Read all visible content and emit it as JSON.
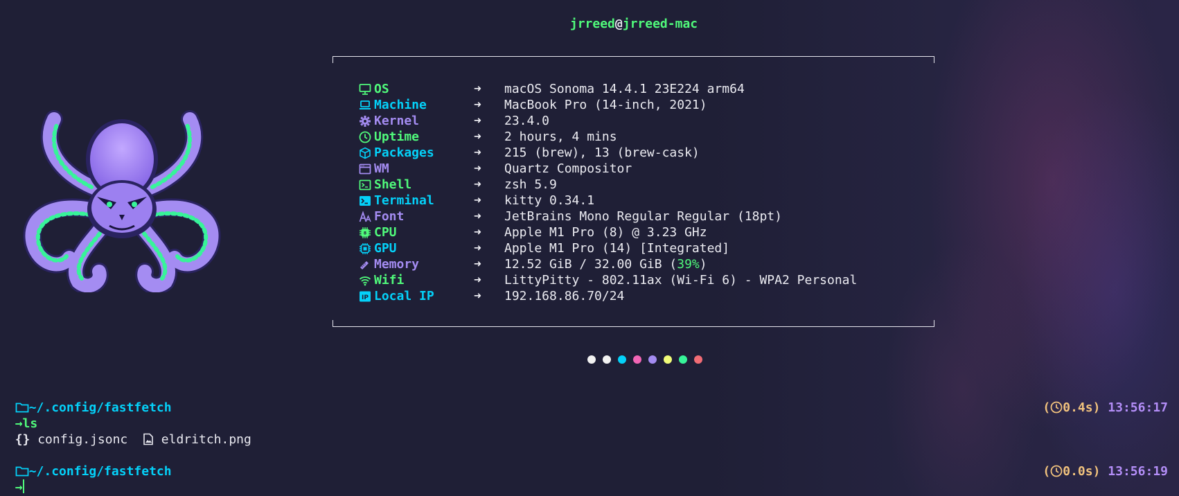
{
  "terminal": {
    "user": "jrreed",
    "at": "@",
    "host": "jrreed-mac",
    "rows": [
      {
        "key": "OS",
        "val": "macOS Sonoma 14.4.1 23E224 arm64",
        "color": "#50fa7b",
        "icon": "monitor-icon"
      },
      {
        "key": "Machine",
        "val": "MacBook Pro (14-inch, 2021)",
        "color": "#04d1f9",
        "icon": "laptop-icon"
      },
      {
        "key": "Kernel",
        "val": "23.4.0",
        "color": "#a48cf2",
        "icon": "gear-icon"
      },
      {
        "key": "Uptime",
        "val": "2 hours, 4 mins",
        "color": "#50fa7b",
        "icon": "clock-icon"
      },
      {
        "key": "Packages",
        "val": "215 (brew), 13 (brew-cask)",
        "color": "#04d1f9",
        "icon": "package-icon"
      },
      {
        "key": "WM",
        "val": "Quartz Compositor",
        "color": "#a48cf2",
        "icon": "window-icon"
      },
      {
        "key": "Shell",
        "val": "zsh 5.9",
        "color": "#50fa7b",
        "icon": "shell-icon"
      },
      {
        "key": "Terminal",
        "val": "kitty 0.34.1",
        "color": "#04d1f9",
        "icon": "terminal-icon"
      },
      {
        "key": "Font",
        "val": "JetBrains Mono Regular Regular (18pt)",
        "color": "#a48cf2",
        "icon": "font-icon"
      },
      {
        "key": "CPU",
        "val": "Apple M1 Pro (8) @ 3.23 GHz",
        "color": "#50fa7b",
        "icon": "cpu-icon"
      },
      {
        "key": "GPU",
        "val": "Apple M1 Pro (14) [Integrated]",
        "color": "#04d1f9",
        "icon": "gpu-icon"
      },
      {
        "key": "Memory",
        "val_prefix": "12.52 GiB / 32.00 GiB (",
        "val_pct": "39%",
        "val_suffix": ")",
        "color": "#a48cf2",
        "icon": "memory-icon"
      },
      {
        "key": "Wifi",
        "val": "LittyPitty - 802.11ax (Wi-Fi 6) - WPA2 Personal",
        "color": "#50fa7b",
        "icon": "wifi-icon"
      },
      {
        "key": "Local IP",
        "val": "192.168.86.70/24",
        "color": "#04d1f9",
        "icon": "ip-icon"
      }
    ],
    "arrow": "➜",
    "palette": [
      "#f2f2f2",
      "#f2f2f2",
      "#04d1f9",
      "#f265b5",
      "#a48cf2",
      "#f1fc79",
      "#37f499",
      "#f16c75"
    ],
    "prompts": [
      {
        "dir": "~/.config/fastfetch",
        "cmd": "ls",
        "duration": "0.4s",
        "time": "13:56:17"
      },
      {
        "dir": "~/.config/fastfetch",
        "cmd": "",
        "duration": "0.0s",
        "time": "13:56:19"
      }
    ],
    "ls_output": [
      {
        "icon": "{}",
        "name": "config.jsonc"
      },
      {
        "icon": "image-file-icon",
        "name": "eldritch.png"
      }
    ]
  }
}
